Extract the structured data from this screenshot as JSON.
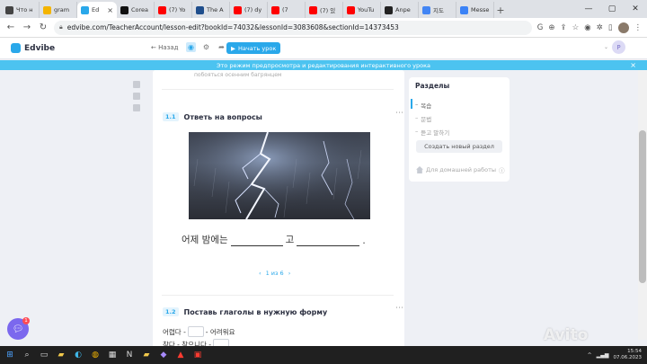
{
  "browser": {
    "tabs": [
      {
        "title": "Что н",
        "icon": "chatgpt-icon",
        "color": "#444444"
      },
      {
        "title": "gram",
        "icon": "grammar-icon",
        "color": "#f4b400"
      },
      {
        "title": "Ed",
        "icon": "edvibe-icon",
        "color": "#2aa8ea",
        "active": true
      },
      {
        "title": "Corea",
        "icon": "coursera-icon",
        "color": "#111111"
      },
      {
        "title": "(7) Yo",
        "icon": "youtube-icon",
        "color": "#ff0000"
      },
      {
        "title": "The A",
        "icon": "site-icon",
        "color": "#1f4e8c"
      },
      {
        "title": "(7) dy",
        "icon": "youtube-icon",
        "color": "#ff0000"
      },
      {
        "title": "(7",
        "icon": "youtube-icon",
        "color": "#ff0000"
      },
      {
        "title": "(7) 있",
        "icon": "youtube-icon",
        "color": "#ff0000"
      },
      {
        "title": "YouTu",
        "icon": "youtube-icon",
        "color": "#ff0000"
      },
      {
        "title": "Anpe",
        "icon": "openai-icon",
        "color": "#222222"
      },
      {
        "title": "지도",
        "icon": "google-icon",
        "color": "#4285f4"
      },
      {
        "title": "Messe",
        "icon": "site-icon",
        "color": "#3b82f6"
      }
    ],
    "address": "edvibe.com/TeacherAccount/lesson-edit?bookId=74032&lessonId=3083608&sectionId=14373453"
  },
  "header": {
    "logo": "Edvibe",
    "back": "Назад",
    "start_button": "Начать урок",
    "avatar_letter": "P"
  },
  "banner": "Это режим предпросмотра и редактирования интерактивного урока",
  "lesson": {
    "prev_hint": "побояться осенним багрянцем",
    "exercise1": {
      "number": "1.1",
      "title": "Ответь на вопросы",
      "image_icon": "thunderstorm-image",
      "sentence_start": "어제 밤에는",
      "sentence_mid": "고",
      "sentence_end": ".",
      "pager": "1 из 6"
    },
    "exercise2": {
      "number": "1.2",
      "title": "Поставь глаголы в нужную форму",
      "line1_start": "어렵다 -",
      "line1_end": "- 어려워요",
      "line2_start": "참다 - 참으니다 -"
    }
  },
  "sections": {
    "title": "Разделы",
    "items": [
      "복습",
      "문법",
      "듣고 말하기"
    ],
    "new_section": "Создать новый раздел",
    "homework": "Для домашней работы",
    "homework_icon": "info-icon"
  },
  "chat": {
    "badge": "1"
  },
  "taskbar": {
    "time": "15:54",
    "date": "07.06.2023"
  },
  "watermark": "Avito",
  "colors": {
    "accent": "#2aa8ea",
    "banner": "#4cc3f0",
    "chat": "#7b68ee",
    "badge": "#ff4b55"
  }
}
